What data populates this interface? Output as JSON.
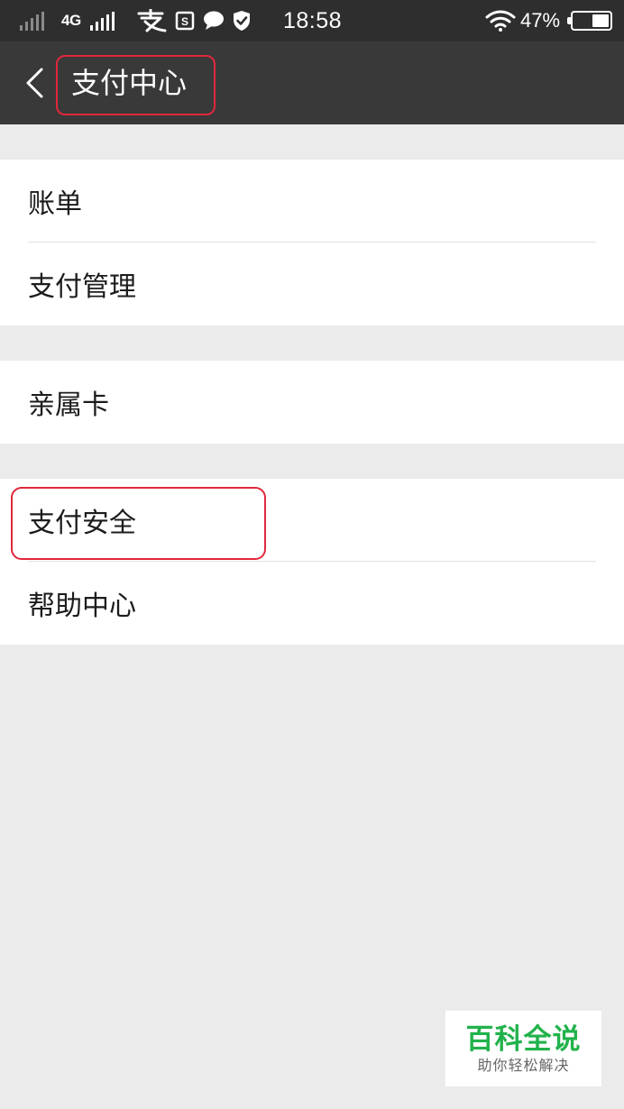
{
  "status_bar": {
    "network": "4G",
    "time": "18:58",
    "battery_percent": "47%",
    "battery_level": 0.47,
    "icons": [
      "signal-sim1-icon",
      "signal-sim2-icon",
      "alipay-icon",
      "sim-s-icon",
      "message-bubble-icon",
      "shield-check-icon",
      "wifi-icon",
      "battery-icon"
    ]
  },
  "header": {
    "back_icon": "chevron-left-icon",
    "title": "支付中心"
  },
  "menu": {
    "group1": [
      {
        "label": "账单"
      },
      {
        "label": "支付管理"
      }
    ],
    "group2": [
      {
        "label": "亲属卡"
      }
    ],
    "group3": [
      {
        "label": "支付安全"
      },
      {
        "label": "帮助中心"
      }
    ]
  },
  "watermark": {
    "title": "百科全说",
    "subtitle": "助你轻松解决"
  },
  "colors": {
    "status_bar_bg": "#2e2e2e",
    "title_bar_bg": "#393939",
    "page_bg": "#ebebeb",
    "highlight": "#e0283c",
    "watermark_green": "#21b24b"
  }
}
